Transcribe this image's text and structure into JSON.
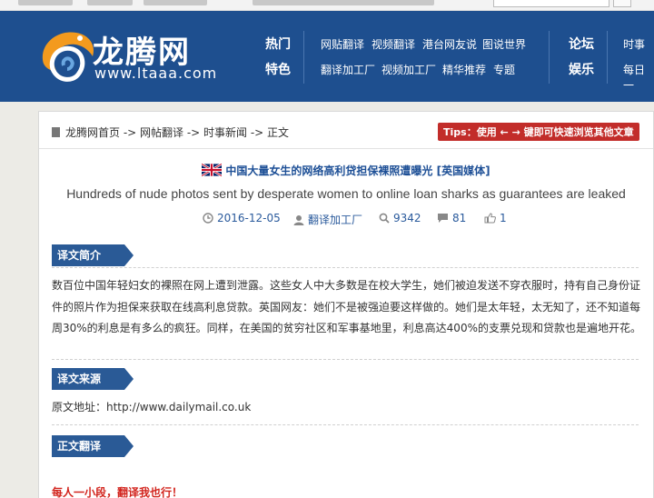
{
  "site": {
    "logo_title": "龙腾网",
    "logo_url": "www.ltaaa.com"
  },
  "nav": {
    "cat_hot": "热门",
    "cat_feature": "特色",
    "row1": [
      "网贴翻译",
      "视频翻译",
      "港台网友说",
      "图说世界"
    ],
    "row2": [
      "翻译加工厂",
      "视频加工厂",
      "精华推荐",
      "专题"
    ],
    "cat_forum": "论坛",
    "cat_entertain": "娱乐",
    "right1": "时事",
    "right2": "每日一"
  },
  "breadcrumb": {
    "text": "龙腾网首页 -> 网帖翻译 -> 时事新闻 -> 正文"
  },
  "tips": "Tips：使用 ← → 键即可快速浏览其他文章",
  "article": {
    "title": "中国大量女生的网络高利贷担保裸照遭曝光 [英国媒体]",
    "subtitle": "Hundreds of nude photos sent by desperate women to online loan sharks as guarantees are leaked",
    "date": "2016-12-05",
    "author": "翻译加工厂",
    "views": "9342",
    "comments": "81",
    "likes": "1"
  },
  "sections": {
    "intro_label": "译文简介",
    "intro_text": "数百位中国年轻妇女的裸照在网上遭到泄露。这些女人中大多数是在校大学生，她们被迫发送不穿衣服时，持有自己身份证件的照片作为担保来获取在线高利息贷款。英国网友：她们不是被强迫要这样做的。她们是太年轻，太无知了，还不知道每周30%的利息是有多么的疯狂。同样，在美国的贫穷社区和军事基地里，利息高达400%的支票兑现和贷款也是遍地开花。",
    "source_label": "译文来源",
    "source_text": "原文地址：http://www.dailymail.co.uk",
    "translation_label": "正文翻译",
    "slogan": "每人一小段，翻译我也行！"
  },
  "colors": {
    "header_bg": "#1e4f8f",
    "section_label": "#2a5a96",
    "tips_bg": "#c22d2a",
    "title_blue": "#1d4f96",
    "slogan_red": "#d2231c"
  }
}
